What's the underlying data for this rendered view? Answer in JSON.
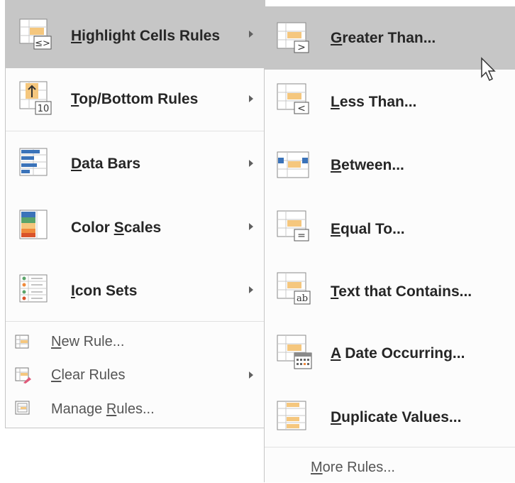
{
  "main_menu": {
    "items": [
      {
        "label": "Highlight Cells Rules",
        "accel": "H",
        "has_submenu": true,
        "highlighted": true
      },
      {
        "label": "Top/Bottom Rules",
        "accel": "T",
        "has_submenu": true
      },
      {
        "label": "Data Bars",
        "accel": "D",
        "has_submenu": true
      },
      {
        "label": "Color Scales",
        "accel": "S",
        "has_submenu": true
      },
      {
        "label": "Icon Sets",
        "accel": "I",
        "has_submenu": true
      }
    ],
    "small_items": [
      {
        "label": "New Rule...",
        "accel": "N",
        "has_submenu": false
      },
      {
        "label": "Clear Rules",
        "accel": "C",
        "has_submenu": true
      },
      {
        "label": "Manage Rules...",
        "accel": "R",
        "has_submenu": false
      }
    ]
  },
  "sub_menu": {
    "items": [
      {
        "label": "Greater Than...",
        "accel": "G",
        "highlighted": true
      },
      {
        "label": "Less Than...",
        "accel": "L"
      },
      {
        "label": "Between...",
        "accel": "B"
      },
      {
        "label": "Equal To...",
        "accel": "E"
      },
      {
        "label": "Text that Contains...",
        "accel": "T"
      },
      {
        "label": "A Date Occurring...",
        "accel": "A"
      },
      {
        "label": "Duplicate Values...",
        "accel": "D"
      }
    ],
    "more_rules": {
      "label": "More Rules...",
      "accel": "M"
    }
  },
  "icon_glyphs": {
    "greater": ">",
    "less": "<",
    "equal": "=",
    "text": "ab",
    "top": "10",
    "highlight": "≤>"
  },
  "colors": {
    "highlight": "#c6c6c6",
    "menu_bg": "#fcfcfc",
    "icon_orange": "#f5c77e",
    "icon_blue": "#3b73b9"
  }
}
